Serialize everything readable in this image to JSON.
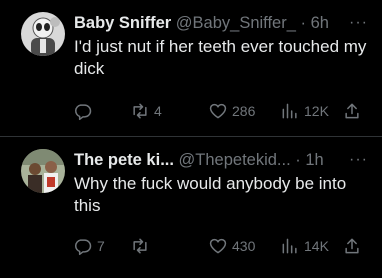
{
  "tweets": [
    {
      "name": "Baby Sniffer",
      "handle": "@Baby_Sniffer_",
      "separator": "·",
      "time": "6h",
      "more": "···",
      "text": "I'd just nut if her teeth ever touched my dick",
      "reply_count": "",
      "retweet_count": "4",
      "like_count": "286",
      "view_count": "12K"
    },
    {
      "name": "The pete ki...",
      "handle": "@Thepetekid...",
      "separator": "·",
      "time": "1h",
      "more": "···",
      "text": "Why the fuck would anybody be into this",
      "reply_count": "7",
      "retweet_count": "",
      "like_count": "430",
      "view_count": "14K"
    }
  ],
  "colors": {
    "background": "#000000",
    "text": "#e7e9ea",
    "muted": "#71767b",
    "divider": "#2f3336"
  },
  "icons": [
    "reply-icon",
    "retweet-icon",
    "like-icon",
    "views-icon",
    "share-icon",
    "more-icon"
  ]
}
